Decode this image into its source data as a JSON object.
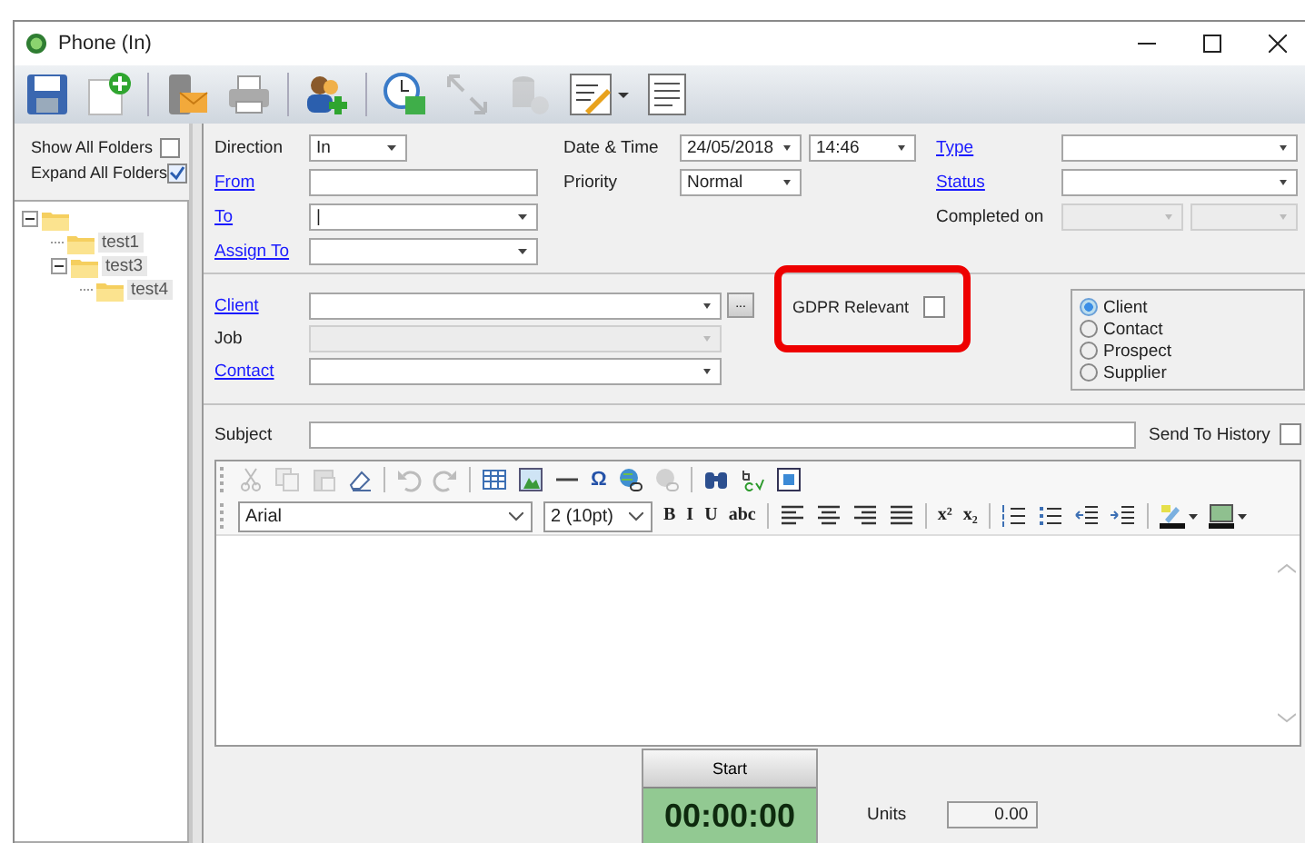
{
  "window": {
    "title": "Phone (In)"
  },
  "toolbar": [
    {
      "kind": "save",
      "disabled": false
    },
    {
      "kind": "new",
      "disabled": false
    },
    {
      "kind": "sep"
    },
    {
      "kind": "email",
      "disabled": false
    },
    {
      "kind": "print",
      "disabled": false
    },
    {
      "kind": "sep"
    },
    {
      "kind": "contacts",
      "disabled": false
    },
    {
      "kind": "sep"
    },
    {
      "kind": "schedule",
      "disabled": false
    },
    {
      "kind": "arrows",
      "disabled": true
    },
    {
      "kind": "coins",
      "disabled": true
    },
    {
      "kind": "signature",
      "disabled": false
    },
    {
      "kind": "caret",
      "disabled": false
    },
    {
      "kind": "document",
      "disabled": false
    }
  ],
  "folder_options": [
    {
      "label": "Show All Folders",
      "checked": false
    },
    {
      "label": "Expand All Folders",
      "checked": true
    }
  ],
  "folder_tree": [
    {
      "expanded": true,
      "children": [
        {
          "label": "test1"
        },
        {
          "label": "test3",
          "expanded": true,
          "children": [
            {
              "label": "test4"
            }
          ]
        }
      ]
    }
  ],
  "details": {
    "column_1": [
      {
        "label": "Direction",
        "link": false,
        "value": "In",
        "dropdown": true,
        "disabled": false
      },
      {
        "label": "From",
        "link": true,
        "dropdown": false,
        "disabled": false
      },
      {
        "label": "To",
        "link": true,
        "value": "|",
        "dropdown": true,
        "disabled": false
      },
      {
        "label": "Assign To",
        "link": true,
        "dropdown": true,
        "disabled": false
      }
    ],
    "date_time": {
      "label": "Date & Time",
      "date": "24/05/2018",
      "time": "14:46"
    },
    "priority": {
      "label": "Priority",
      "value": "Normal"
    },
    "column_3": [
      {
        "label": "Type",
        "link": true,
        "disabled": false
      },
      {
        "label": "Status",
        "link": true,
        "disabled": false
      }
    ],
    "completed_on": {
      "label": "Completed on",
      "disabled": true
    }
  },
  "client_section": [
    {
      "label": "Client",
      "link": true,
      "disabled": false,
      "lookup": true
    },
    {
      "label": "Job",
      "link": false,
      "disabled": true,
      "lookup": false
    },
    {
      "label": "Contact",
      "link": true,
      "disabled": false,
      "lookup": false
    }
  ],
  "lookup_button": {
    "text": "..."
  },
  "gdpr": {
    "label": "GDPR Relevant",
    "checked": false,
    "highlighted": true
  },
  "record_types": [
    {
      "label": "Client",
      "selected": true
    },
    {
      "label": "Contact",
      "selected": false
    },
    {
      "label": "Prospect",
      "selected": false
    },
    {
      "label": "Supplier",
      "selected": false
    }
  ],
  "subject": {
    "label": "Subject"
  },
  "send_to_history": {
    "label": "Send To History",
    "checked": false
  },
  "editor_toolbar_1": [
    {
      "kind": "cut",
      "disabled": true
    },
    {
      "kind": "copy",
      "disabled": true
    },
    {
      "kind": "paste",
      "disabled": true
    },
    {
      "kind": "eraser",
      "disabled": false
    },
    {
      "kind": "sep"
    },
    {
      "kind": "undo",
      "disabled": true
    },
    {
      "kind": "redo",
      "disabled": true
    },
    {
      "kind": "sep"
    },
    {
      "kind": "table",
      "disabled": false
    },
    {
      "kind": "image",
      "disabled": false
    },
    {
      "kind": "rule",
      "disabled": false
    },
    {
      "kind": "glyph",
      "text": "Ω",
      "disabled": false
    },
    {
      "kind": "link",
      "disabled": false
    },
    {
      "kind": "unlink",
      "disabled": true
    },
    {
      "kind": "sep"
    },
    {
      "kind": "find",
      "disabled": false
    },
    {
      "kind": "spell",
      "disabled": false
    },
    {
      "kind": "select",
      "disabled": false
    }
  ],
  "font": {
    "family": "Arial",
    "size": "2 (10pt)"
  },
  "editor_toolbar_2": [
    {
      "kind": "glyph",
      "text": "B",
      "disabled": false
    },
    {
      "kind": "glyph",
      "text": "I",
      "disabled": false
    },
    {
      "kind": "glyph",
      "text": "U",
      "disabled": false
    },
    {
      "kind": "glyph",
      "text": "abc",
      "disabled": false
    },
    {
      "kind": "sep"
    },
    {
      "kind": "align-left",
      "disabled": false
    },
    {
      "kind": "align-center",
      "disabled": false
    },
    {
      "kind": "align-right",
      "disabled": false
    },
    {
      "kind": "justify",
      "disabled": false
    },
    {
      "kind": "sep"
    },
    {
      "kind": "glyph",
      "text": "x²",
      "disabled": false
    },
    {
      "kind": "glyph",
      "text": "x₂",
      "disabled": false
    },
    {
      "kind": "sep"
    },
    {
      "kind": "ordered-list",
      "disabled": false
    },
    {
      "kind": "bullet-list",
      "disabled": false
    },
    {
      "kind": "outdent",
      "disabled": false
    },
    {
      "kind": "indent",
      "disabled": false
    },
    {
      "kind": "sep"
    },
    {
      "kind": "highlight",
      "disabled": false
    },
    {
      "kind": "caret",
      "disabled": false
    },
    {
      "kind": "background",
      "disabled": false
    },
    {
      "kind": "caret",
      "disabled": false
    }
  ],
  "timer": {
    "button": "Start",
    "time": "00:00:00"
  },
  "units": {
    "label": "Units",
    "value": "0.00"
  }
}
